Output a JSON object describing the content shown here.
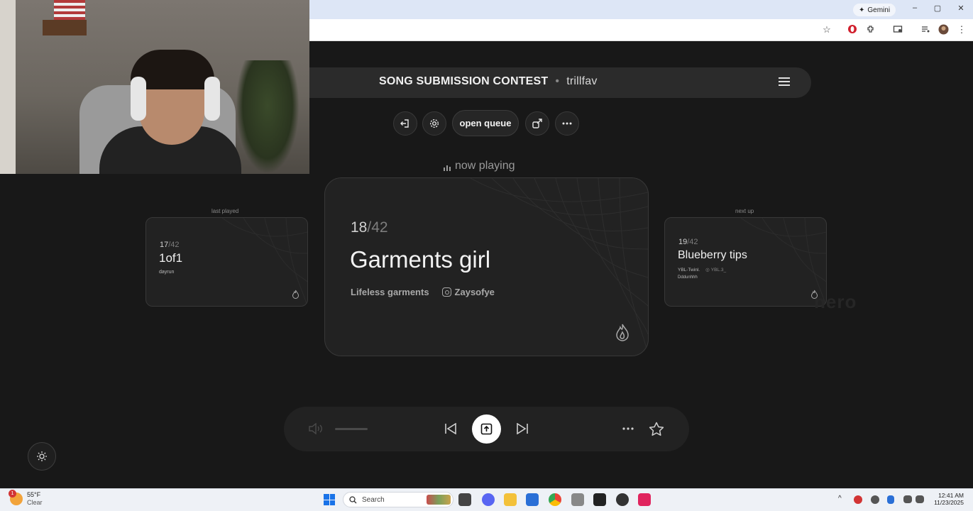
{
  "browser": {
    "gemini_label": "Gemini",
    "window_controls": {
      "minimize": "–",
      "maximize": "▢",
      "close": "✕"
    }
  },
  "header": {
    "title": "SONG SUBMISSION CONTEST",
    "separator": "•",
    "username": "trillfav"
  },
  "controls": {
    "open_queue": "open queue"
  },
  "now_playing": {
    "label": "now playing",
    "position": "18",
    "total": "/42",
    "title": "Garments girl",
    "artist": "Lifeless garments",
    "instagram": "Zaysofye"
  },
  "last_played": {
    "label": "last played",
    "position": "17",
    "total": "/42",
    "title": "1of1",
    "submitter": "dayrun"
  },
  "next_up": {
    "label": "next up",
    "position": "19",
    "total": "/42",
    "title": "Blueberry tips",
    "artist": "YBL-Twinl.",
    "instagram": "YBL.3_",
    "submitter": "Dddunhhh"
  },
  "watermark": "nero",
  "player": {
    "volume_level": 0
  },
  "taskbar": {
    "weather_temp": "55°F",
    "weather_condition": "Clear",
    "weather_badge": "1",
    "search_placeholder": "Search",
    "time": "12:41 AM",
    "date": "11/23/2025"
  },
  "colors": {
    "background": "#181818",
    "card": "#222222",
    "accent_white": "#ffffff"
  }
}
